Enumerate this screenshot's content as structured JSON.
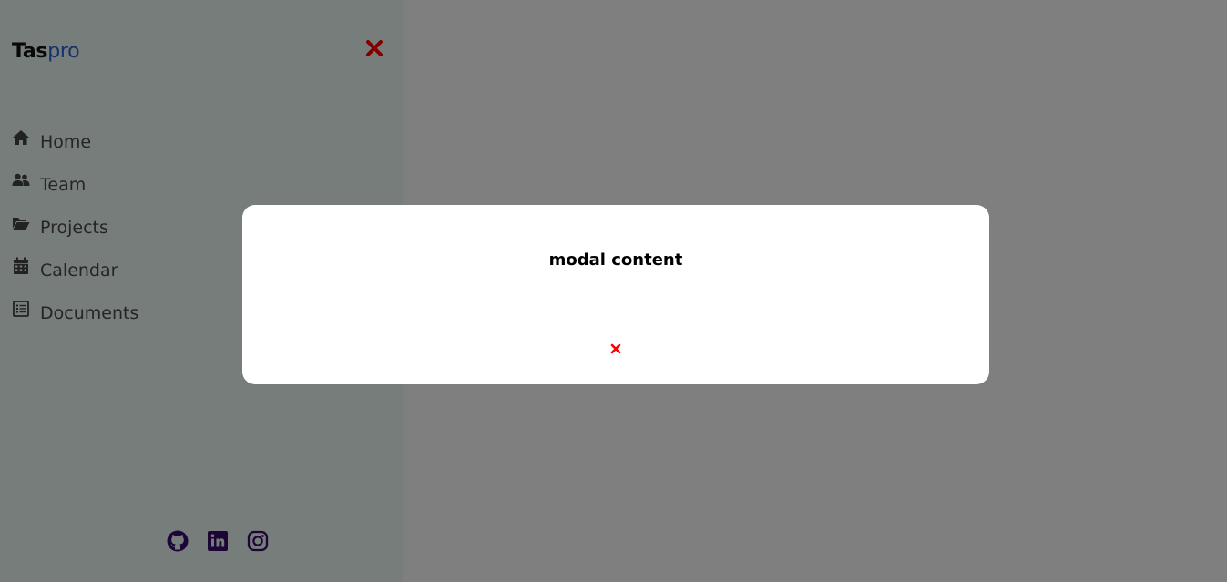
{
  "sidebar": {
    "brand": {
      "part1": "Tas",
      "part2": "pro"
    },
    "close_icon": "close-icon",
    "items": [
      {
        "label": "Home",
        "icon": "home-icon"
      },
      {
        "label": "Team",
        "icon": "users-icon"
      },
      {
        "label": "Projects",
        "icon": "folder-open-icon"
      },
      {
        "label": "Calendar",
        "icon": "calendar-icon"
      },
      {
        "label": "Documents",
        "icon": "document-list-icon"
      }
    ],
    "socials": [
      {
        "name": "GitHub",
        "icon": "github-icon"
      },
      {
        "name": "LinkedIn",
        "icon": "linkedin-icon"
      },
      {
        "name": "Instagram",
        "icon": "instagram-icon"
      }
    ]
  },
  "modal": {
    "text": "modal content",
    "close_icon": "close-icon"
  },
  "colors": {
    "sidebar_bg": "#eefaf6",
    "brand_accent": "#2f63d6",
    "close_red": "#ff0000",
    "social_purple": "#3b0a6e",
    "overlay": "rgba(0,0,0,0.5)"
  }
}
